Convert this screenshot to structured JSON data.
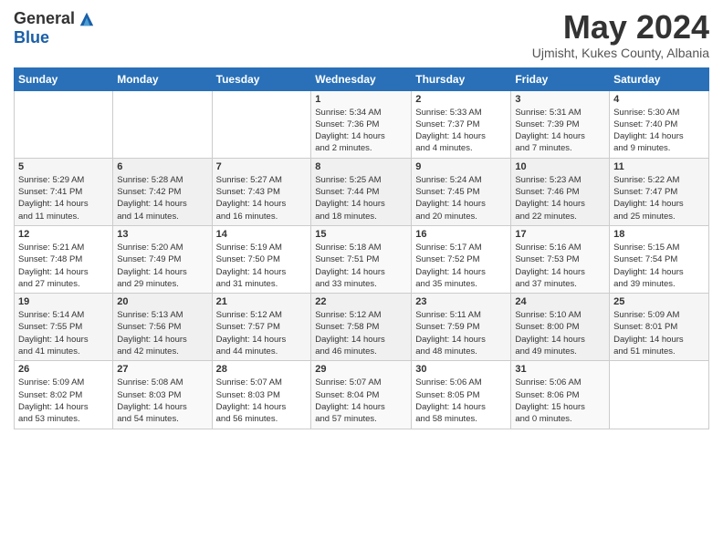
{
  "header": {
    "logo_general": "General",
    "logo_blue": "Blue",
    "month_title": "May 2024",
    "location": "Ujmisht, Kukes County, Albania"
  },
  "days_of_week": [
    "Sunday",
    "Monday",
    "Tuesday",
    "Wednesday",
    "Thursday",
    "Friday",
    "Saturday"
  ],
  "weeks": [
    [
      {
        "day": "",
        "sunrise": "",
        "sunset": "",
        "daylight": ""
      },
      {
        "day": "",
        "sunrise": "",
        "sunset": "",
        "daylight": ""
      },
      {
        "day": "",
        "sunrise": "",
        "sunset": "",
        "daylight": ""
      },
      {
        "day": "1",
        "sunrise": "Sunrise: 5:34 AM",
        "sunset": "Sunset: 7:36 PM",
        "daylight": "Daylight: 14 hours and 2 minutes."
      },
      {
        "day": "2",
        "sunrise": "Sunrise: 5:33 AM",
        "sunset": "Sunset: 7:37 PM",
        "daylight": "Daylight: 14 hours and 4 minutes."
      },
      {
        "day": "3",
        "sunrise": "Sunrise: 5:31 AM",
        "sunset": "Sunset: 7:39 PM",
        "daylight": "Daylight: 14 hours and 7 minutes."
      },
      {
        "day": "4",
        "sunrise": "Sunrise: 5:30 AM",
        "sunset": "Sunset: 7:40 PM",
        "daylight": "Daylight: 14 hours and 9 minutes."
      }
    ],
    [
      {
        "day": "5",
        "sunrise": "Sunrise: 5:29 AM",
        "sunset": "Sunset: 7:41 PM",
        "daylight": "Daylight: 14 hours and 11 minutes."
      },
      {
        "day": "6",
        "sunrise": "Sunrise: 5:28 AM",
        "sunset": "Sunset: 7:42 PM",
        "daylight": "Daylight: 14 hours and 14 minutes."
      },
      {
        "day": "7",
        "sunrise": "Sunrise: 5:27 AM",
        "sunset": "Sunset: 7:43 PM",
        "daylight": "Daylight: 14 hours and 16 minutes."
      },
      {
        "day": "8",
        "sunrise": "Sunrise: 5:25 AM",
        "sunset": "Sunset: 7:44 PM",
        "daylight": "Daylight: 14 hours and 18 minutes."
      },
      {
        "day": "9",
        "sunrise": "Sunrise: 5:24 AM",
        "sunset": "Sunset: 7:45 PM",
        "daylight": "Daylight: 14 hours and 20 minutes."
      },
      {
        "day": "10",
        "sunrise": "Sunrise: 5:23 AM",
        "sunset": "Sunset: 7:46 PM",
        "daylight": "Daylight: 14 hours and 22 minutes."
      },
      {
        "day": "11",
        "sunrise": "Sunrise: 5:22 AM",
        "sunset": "Sunset: 7:47 PM",
        "daylight": "Daylight: 14 hours and 25 minutes."
      }
    ],
    [
      {
        "day": "12",
        "sunrise": "Sunrise: 5:21 AM",
        "sunset": "Sunset: 7:48 PM",
        "daylight": "Daylight: 14 hours and 27 minutes."
      },
      {
        "day": "13",
        "sunrise": "Sunrise: 5:20 AM",
        "sunset": "Sunset: 7:49 PM",
        "daylight": "Daylight: 14 hours and 29 minutes."
      },
      {
        "day": "14",
        "sunrise": "Sunrise: 5:19 AM",
        "sunset": "Sunset: 7:50 PM",
        "daylight": "Daylight: 14 hours and 31 minutes."
      },
      {
        "day": "15",
        "sunrise": "Sunrise: 5:18 AM",
        "sunset": "Sunset: 7:51 PM",
        "daylight": "Daylight: 14 hours and 33 minutes."
      },
      {
        "day": "16",
        "sunrise": "Sunrise: 5:17 AM",
        "sunset": "Sunset: 7:52 PM",
        "daylight": "Daylight: 14 hours and 35 minutes."
      },
      {
        "day": "17",
        "sunrise": "Sunrise: 5:16 AM",
        "sunset": "Sunset: 7:53 PM",
        "daylight": "Daylight: 14 hours and 37 minutes."
      },
      {
        "day": "18",
        "sunrise": "Sunrise: 5:15 AM",
        "sunset": "Sunset: 7:54 PM",
        "daylight": "Daylight: 14 hours and 39 minutes."
      }
    ],
    [
      {
        "day": "19",
        "sunrise": "Sunrise: 5:14 AM",
        "sunset": "Sunset: 7:55 PM",
        "daylight": "Daylight: 14 hours and 41 minutes."
      },
      {
        "day": "20",
        "sunrise": "Sunrise: 5:13 AM",
        "sunset": "Sunset: 7:56 PM",
        "daylight": "Daylight: 14 hours and 42 minutes."
      },
      {
        "day": "21",
        "sunrise": "Sunrise: 5:12 AM",
        "sunset": "Sunset: 7:57 PM",
        "daylight": "Daylight: 14 hours and 44 minutes."
      },
      {
        "day": "22",
        "sunrise": "Sunrise: 5:12 AM",
        "sunset": "Sunset: 7:58 PM",
        "daylight": "Daylight: 14 hours and 46 minutes."
      },
      {
        "day": "23",
        "sunrise": "Sunrise: 5:11 AM",
        "sunset": "Sunset: 7:59 PM",
        "daylight": "Daylight: 14 hours and 48 minutes."
      },
      {
        "day": "24",
        "sunrise": "Sunrise: 5:10 AM",
        "sunset": "Sunset: 8:00 PM",
        "daylight": "Daylight: 14 hours and 49 minutes."
      },
      {
        "day": "25",
        "sunrise": "Sunrise: 5:09 AM",
        "sunset": "Sunset: 8:01 PM",
        "daylight": "Daylight: 14 hours and 51 minutes."
      }
    ],
    [
      {
        "day": "26",
        "sunrise": "Sunrise: 5:09 AM",
        "sunset": "Sunset: 8:02 PM",
        "daylight": "Daylight: 14 hours and 53 minutes."
      },
      {
        "day": "27",
        "sunrise": "Sunrise: 5:08 AM",
        "sunset": "Sunset: 8:03 PM",
        "daylight": "Daylight: 14 hours and 54 minutes."
      },
      {
        "day": "28",
        "sunrise": "Sunrise: 5:07 AM",
        "sunset": "Sunset: 8:03 PM",
        "daylight": "Daylight: 14 hours and 56 minutes."
      },
      {
        "day": "29",
        "sunrise": "Sunrise: 5:07 AM",
        "sunset": "Sunset: 8:04 PM",
        "daylight": "Daylight: 14 hours and 57 minutes."
      },
      {
        "day": "30",
        "sunrise": "Sunrise: 5:06 AM",
        "sunset": "Sunset: 8:05 PM",
        "daylight": "Daylight: 14 hours and 58 minutes."
      },
      {
        "day": "31",
        "sunrise": "Sunrise: 5:06 AM",
        "sunset": "Sunset: 8:06 PM",
        "daylight": "Daylight: 15 hours and 0 minutes."
      },
      {
        "day": "",
        "sunrise": "",
        "sunset": "",
        "daylight": ""
      }
    ]
  ]
}
